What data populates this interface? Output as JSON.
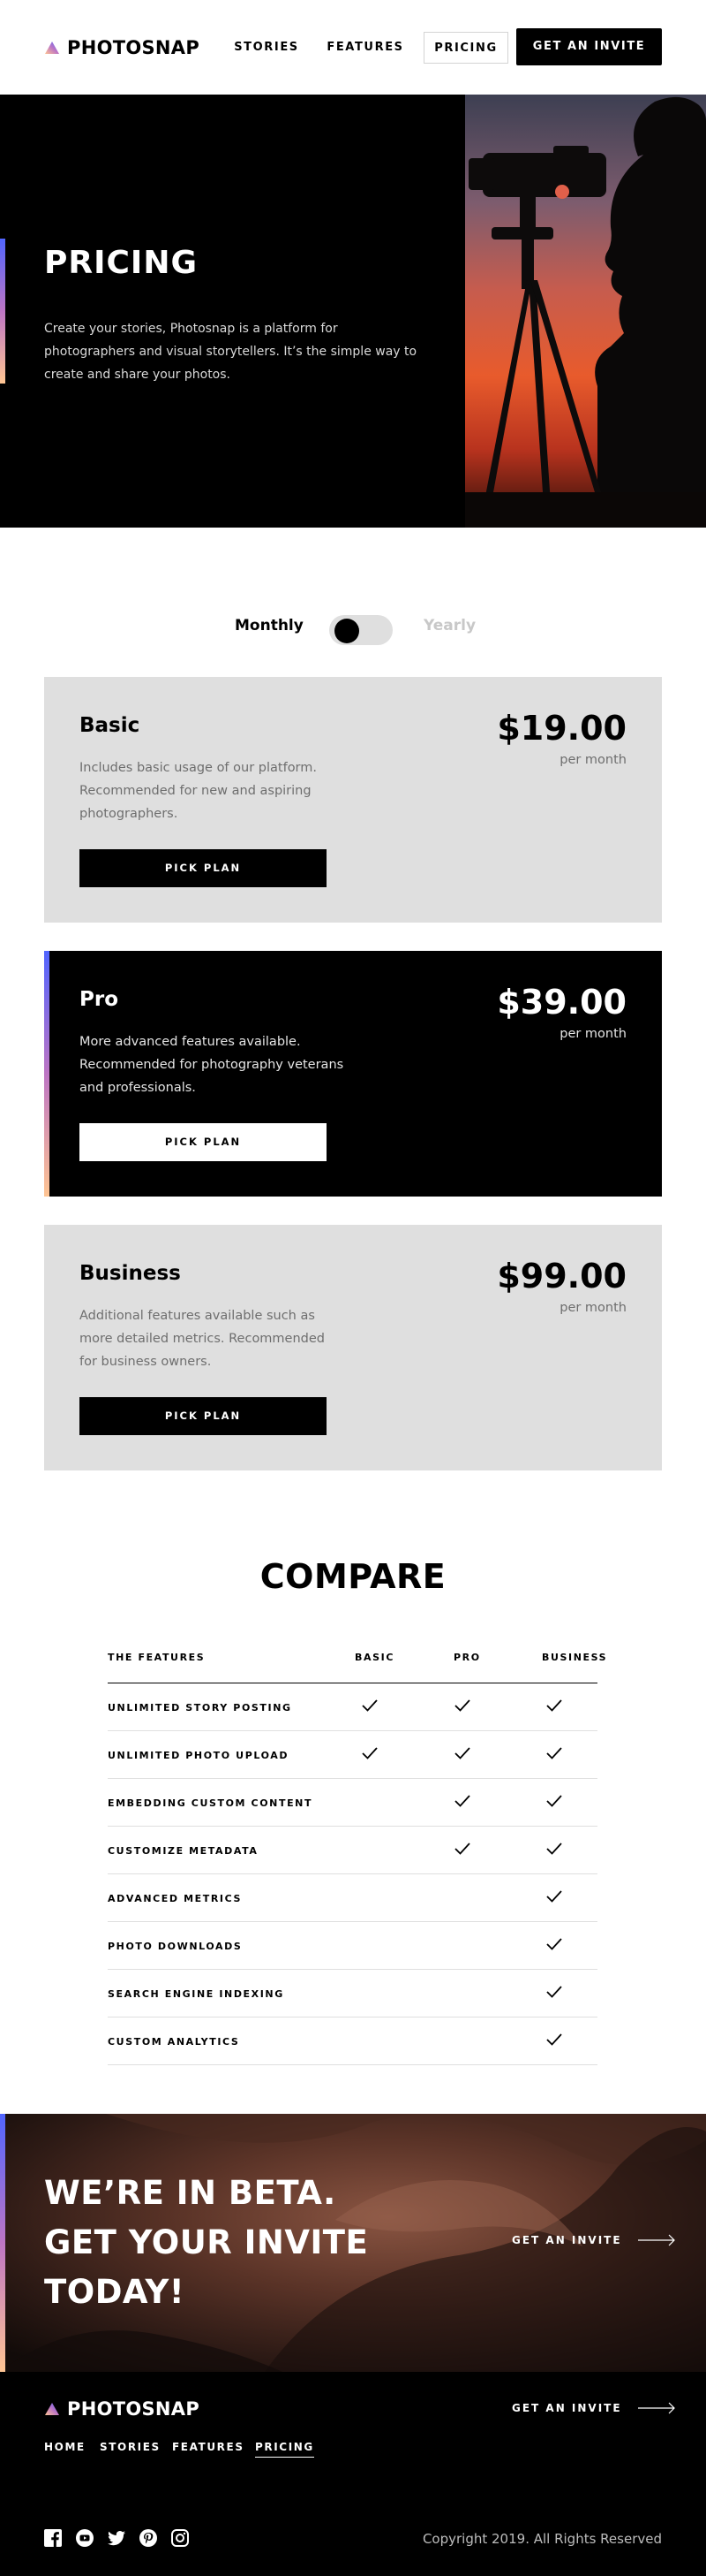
{
  "header": {
    "logo_text": "PHOTOSNAP",
    "nav": [
      "STORIES",
      "FEATURES",
      "PRICING"
    ],
    "active_nav": "PRICING",
    "invite_label": "GET AN INVITE"
  },
  "hero": {
    "title": "PRICING",
    "text": "Create your stories, Photosnap is a platform for photographers and visual storytellers. It’s the simple way to create and share your photos."
  },
  "billing_toggle": {
    "monthly_label": "Monthly",
    "yearly_label": "Yearly",
    "selected": "Monthly"
  },
  "plans": [
    {
      "name": "Basic",
      "description": "Includes basic usage of our platform. Recommended for new and aspiring photographers.",
      "price": "$19.00",
      "period": "per month",
      "button": "PICK PLAN"
    },
    {
      "name": "Pro",
      "description": "More advanced features available. Recommended for photography veterans and professionals.",
      "price": "$39.00",
      "period": "per month",
      "button": "PICK PLAN"
    },
    {
      "name": "Business",
      "description": "Additional features available such as more detailed metrics. Recommended for business owners.",
      "price": "$99.00",
      "period": "per month",
      "button": "PICK PLAN"
    }
  ],
  "compare": {
    "title": "COMPARE",
    "headers": [
      "THE FEATURES",
      "BASIC",
      "PRO",
      "BUSINESS"
    ],
    "rows": [
      {
        "feature": "UNLIMITED STORY POSTING",
        "basic": true,
        "pro": true,
        "business": true
      },
      {
        "feature": "UNLIMITED PHOTO UPLOAD",
        "basic": true,
        "pro": true,
        "business": true
      },
      {
        "feature": "EMBEDDING CUSTOM CONTENT",
        "basic": false,
        "pro": true,
        "business": true
      },
      {
        "feature": "CUSTOMIZE METADATA",
        "basic": false,
        "pro": true,
        "business": true
      },
      {
        "feature": "ADVANCED METRICS",
        "basic": false,
        "pro": false,
        "business": true
      },
      {
        "feature": "PHOTO DOWNLOADS",
        "basic": false,
        "pro": false,
        "business": true
      },
      {
        "feature": "SEARCH ENGINE INDEXING",
        "basic": false,
        "pro": false,
        "business": true
      },
      {
        "feature": "CUSTOM ANALYTICS",
        "basic": false,
        "pro": false,
        "business": true
      }
    ]
  },
  "beta": {
    "lines": [
      "WE’RE IN BETA.",
      "GET YOUR INVITE",
      "TODAY!"
    ],
    "link": "GET AN INVITE"
  },
  "footer": {
    "logo_text": "PHOTOSNAP",
    "link": "GET AN INVITE",
    "nav": [
      "HOME",
      "STORIES",
      "FEATURES",
      "PRICING"
    ],
    "active_nav": "PRICING",
    "socials": [
      "facebook-icon",
      "youtube-icon",
      "twitter-icon",
      "pinterest-icon",
      "instagram-icon"
    ],
    "copyright": "Copyright 2019. All Rights Reserved"
  },
  "colors": {
    "accent_gradient": [
      "#5165ff",
      "#bd75c4",
      "#ffc593"
    ],
    "card_light": "#dfdfdf",
    "card_dark": "#000000"
  }
}
